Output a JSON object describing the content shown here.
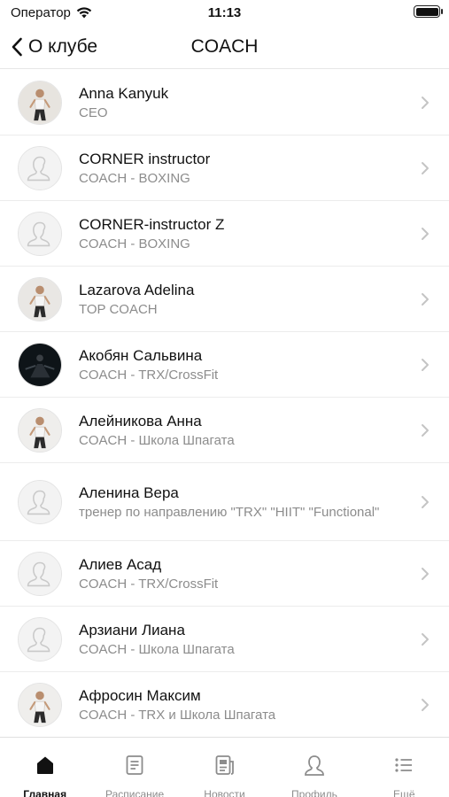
{
  "status_bar": {
    "carrier": "Оператор",
    "time": "11:13",
    "battery_level": 1.0
  },
  "nav": {
    "back_label": "О клубе",
    "title": "COACH"
  },
  "coaches": [
    {
      "name": "Anna Kanyuk",
      "role": "CEO",
      "avatar": "photo"
    },
    {
      "name": "CORNER instructor",
      "role": "COACH - BOXING",
      "avatar": "placeholder"
    },
    {
      "name": "CORNER-instructor Z",
      "role": "COACH - BOXING",
      "avatar": "placeholder"
    },
    {
      "name": "Lazarova Adelina",
      "role": "TOP COACH",
      "avatar": "photo"
    },
    {
      "name": "Акобян Сальвина",
      "role": "COACH - TRX/CrossFit",
      "avatar": "photo-dark"
    },
    {
      "name": "Алейникова Анна",
      "role": "COACH - Школа Шпагата",
      "avatar": "photo"
    },
    {
      "name": "Аленина  Вера",
      "role": "тренер по направлению \"TRX\" \"HIIT\" \"Functional\"",
      "avatar": "placeholder"
    },
    {
      "name": "Алиев Асад",
      "role": "COACH - TRX/CrossFit",
      "avatar": "placeholder"
    },
    {
      "name": "Арзиани Лиана",
      "role": "COACH - Школа Шпагата",
      "avatar": "placeholder"
    },
    {
      "name": "Афросин Максим",
      "role": "COACH - TRX и Школа Шпагата",
      "avatar": "photo"
    }
  ],
  "tabs": [
    {
      "label": "Главная",
      "icon": "home-icon",
      "active": true
    },
    {
      "label": "Расписание",
      "icon": "schedule-icon",
      "active": false
    },
    {
      "label": "Новости",
      "icon": "news-icon",
      "active": false
    },
    {
      "label": "Профиль",
      "icon": "profile-icon",
      "active": false
    },
    {
      "label": "Ещё",
      "icon": "more-icon",
      "active": false
    }
  ],
  "colors": {
    "text": "#111111",
    "secondary": "#8c8c8c",
    "separator": "#ececec",
    "chevron": "#c4c4c4"
  }
}
